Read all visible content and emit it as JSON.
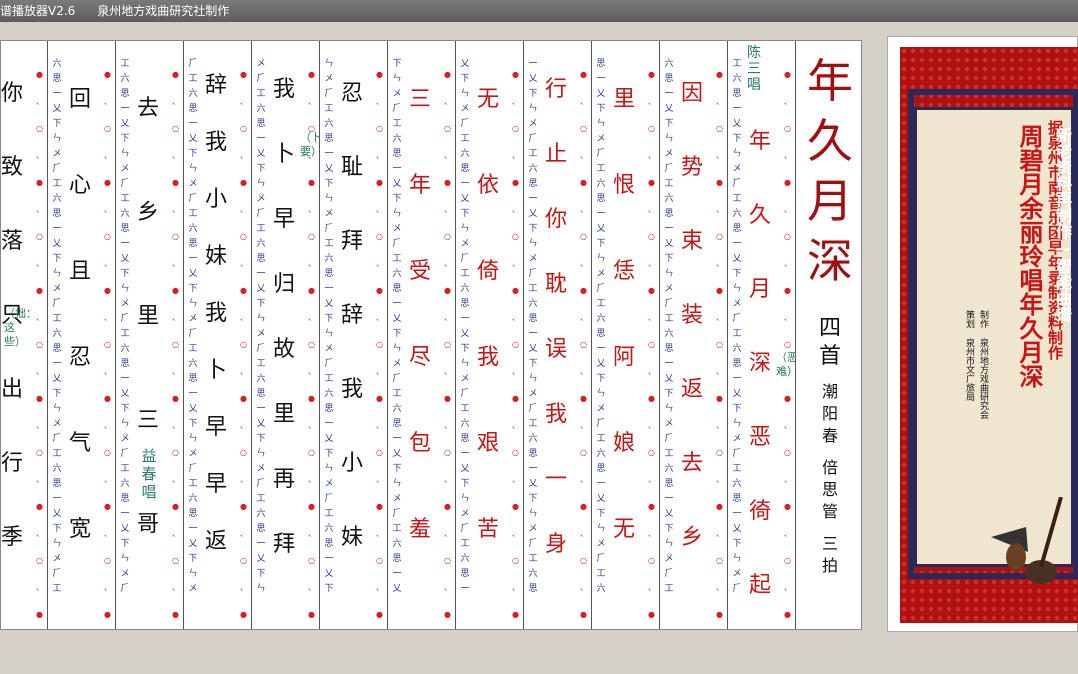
{
  "window": {
    "title_left": "谱播放器V2.6",
    "title_right": "泉州地方戏曲研究社制作"
  },
  "score": {
    "title": [
      "年",
      "久",
      "月",
      "深"
    ],
    "count": "四首",
    "meta": [
      "潮",
      "阳",
      "春"
    ],
    "meta2": [
      "倍",
      "思",
      "管"
    ],
    "meta3": [
      "三",
      "拍"
    ],
    "singer1": "陈三唱",
    "singer2": "益春唱",
    "notes_colored": [
      {
        "id": "c1",
        "text": [
          "年",
          "久",
          "月",
          "深",
          "恶",
          "徛",
          "起"
        ],
        "color": "red"
      },
      {
        "id": "c2",
        "text": [
          "因",
          "势",
          "束",
          "装",
          "返",
          "去",
          "乡"
        ],
        "color": "red"
      },
      {
        "id": "c3",
        "text": [
          "里",
          "恨",
          "恁",
          "阿",
          "娘",
          "无"
        ],
        "color": "red"
      },
      {
        "id": "c4",
        "text": [
          "行",
          "止",
          "你",
          "耽",
          "误",
          "我",
          "一",
          "身"
        ],
        "color": "red"
      },
      {
        "id": "c5",
        "text": [
          "无",
          "依",
          "倚",
          "我",
          "艰",
          "苦"
        ],
        "color": "red"
      },
      {
        "id": "c6",
        "text": [
          "三",
          "年",
          "受",
          "尽",
          "包",
          "羞"
        ],
        "color": "red"
      },
      {
        "id": "c7",
        "text": [
          "忍",
          "耻",
          "拜",
          "辞",
          "我",
          "小",
          "妹"
        ],
        "color": "black"
      },
      {
        "id": "c8",
        "text": [
          "我",
          "卜",
          "早",
          "归",
          "故",
          "里",
          "再",
          "拜"
        ],
        "color": "black"
      },
      {
        "id": "c9",
        "text": [
          "辞",
          "我",
          "小",
          "妹",
          "我",
          "卜",
          "早",
          "早",
          "返"
        ],
        "color": "black"
      },
      {
        "id": "c10",
        "text": [
          "去",
          "乡",
          "里",
          "三",
          "哥"
        ],
        "color": "black"
      },
      {
        "id": "c11",
        "text": [
          "回",
          "心",
          "且",
          "忍",
          "气",
          "宽"
        ],
        "color": "black"
      },
      {
        "id": "c12",
        "text": [
          "你",
          "致",
          "落",
          "只",
          "出",
          "行",
          "季"
        ],
        "color": "black"
      }
    ],
    "annotations": {
      "a1": "（恶、难）",
      "a2": "（卜…要）",
      "a3": "（拙：这些）"
    }
  },
  "cover": {
    "line1": "据泉州市南音乐团早年录制资料制作",
    "line2": "周碧月余丽玲唱年久月深",
    "line3_a": "制作 泉州地方戏曲研究会",
    "line3_b": "策划 泉州市文广旅局",
    "white_text": "新老资料再制作—智能曲谱"
  }
}
